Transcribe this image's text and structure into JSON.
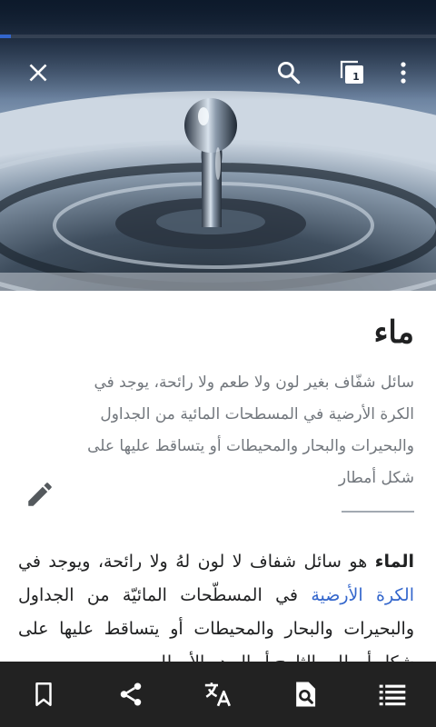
{
  "article": {
    "title": "ماء",
    "description": "سائل شفّاف بغير لون ولا طعم ولا رائحة، يوجد في الكرة الأرضية في المسطحات المائية من الجداول والبحيرات والبحار والمحيطات أو يتساقط عليها على شكل أمطار",
    "body": {
      "bold_term": "الماء",
      "text_1": " هو سائل شفاف لا لون لهُ ولا رائحة، ويوجد في ",
      "link_text": "الكرة الأرضية",
      "text_2": " في المسطّحات المائيّة من الجداول والبحيرات والبحار والمحيطات أو يتساقط عليها على شكل أمطار والثلوج أو البرد والأمطار"
    }
  },
  "toolbar": {
    "tabs_count": "1",
    "icons": [
      "close-icon",
      "search-icon",
      "tabs-icon",
      "overflow-menu-icon"
    ]
  },
  "load_progress": 0.025,
  "bottom_bar": {
    "icons": [
      "bookmark-icon",
      "share-icon",
      "translate-icon",
      "find-in-page-icon",
      "table-of-contents-icon"
    ]
  },
  "colors": {
    "link": "#3366cc",
    "progress": "#3366cc",
    "bottom_bar_bg": "#222222",
    "title": "#202122",
    "description": "#72777d"
  }
}
